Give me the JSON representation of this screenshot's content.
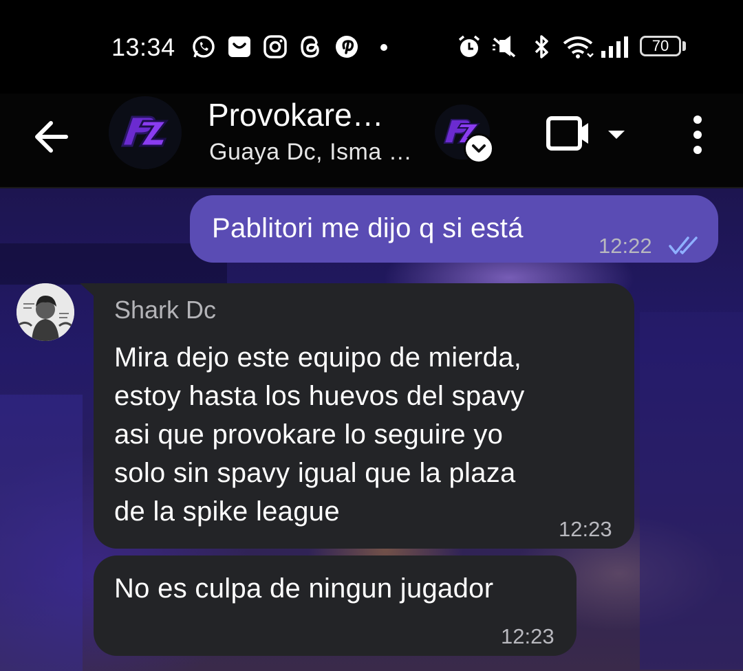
{
  "status_bar": {
    "time": "13:34",
    "notification_icons": [
      "whatsapp-icon",
      "inbox-icon",
      "instagram-icon",
      "threads-icon",
      "pinterest-icon",
      "more-dot-icon"
    ],
    "system_icons": [
      "alarm-icon",
      "silent-icon",
      "bluetooth-icon",
      "wifi-icon",
      "signal-icon"
    ],
    "battery": "70"
  },
  "header": {
    "title": "Provokare…",
    "subtitle": "Guaya Dc, Isma …"
  },
  "messages": [
    {
      "direction": "outgoing",
      "text": "Pablitori me dijo q si está",
      "time": "12:22",
      "status": "read"
    },
    {
      "direction": "incoming",
      "sender": "Shark Dc",
      "text": "Mira dejo este equipo de mierda,\nestoy hasta los huevos del spavy\nasi que provokare lo seguire yo\nsolo sin spavy igual que la plaza\nde la spike league",
      "time": "12:23"
    },
    {
      "direction": "incoming",
      "text": "No es culpa de ningun jugador",
      "time": "12:23"
    }
  ],
  "colors": {
    "outgoing_bubble": "#5a4cb4",
    "incoming_bubble": "#232427",
    "read_ticks": "#8fb0ff"
  }
}
